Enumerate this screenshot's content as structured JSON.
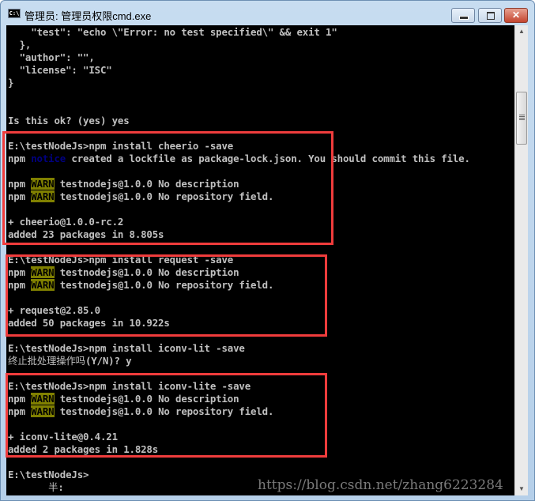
{
  "window": {
    "title": "管理员: 管理员权限cmd.exe",
    "icon": "cmd-icon",
    "icon_text": "C:\\_",
    "buttons": {
      "minimize": "minimize-icon",
      "maximize": "maximize-icon",
      "close": "✕"
    }
  },
  "console": {
    "lines": [
      {
        "text": "    \"test\": \"echo \\\"Error: no test specified\\\" && exit 1\""
      },
      {
        "text": "  },"
      },
      {
        "text": "  \"author\": \"\","
      },
      {
        "text": "  \"license\": \"ISC\""
      },
      {
        "text": "}"
      },
      {
        "text": ""
      },
      {
        "text": ""
      },
      {
        "text": "Is this ok? (yes) yes"
      },
      {
        "text": ""
      },
      {
        "text": "E:\\testNodeJs>npm install cheerio -save"
      },
      {
        "prefix": "npm ",
        "tag": "notice",
        "rest": " created a lockfile as package-lock.json. You should commit this file."
      },
      {
        "text": ""
      },
      {
        "prefix": "npm ",
        "tag": "WARN",
        "rest": " testnodejs@1.0.0 No description"
      },
      {
        "prefix": "npm ",
        "tag": "WARN",
        "rest": " testnodejs@1.0.0 No repository field."
      },
      {
        "text": ""
      },
      {
        "text": "+ cheerio@1.0.0-rc.2"
      },
      {
        "text": "added 23 packages in 8.805s"
      },
      {
        "text": ""
      },
      {
        "text": "E:\\testNodeJs>npm install request -save"
      },
      {
        "prefix": "npm ",
        "tag": "WARN",
        "rest": " testnodejs@1.0.0 No description"
      },
      {
        "prefix": "npm ",
        "tag": "WARN",
        "rest": " testnodejs@1.0.0 No repository field."
      },
      {
        "text": ""
      },
      {
        "text": "+ request@2.85.0"
      },
      {
        "text": "added 50 packages in 10.922s"
      },
      {
        "text": ""
      },
      {
        "text": "E:\\testNodeJs>npm install iconv-lit -save"
      },
      {
        "cjk": "终止批处理操作吗",
        "rest": "(Y/N)? y"
      },
      {
        "text": ""
      },
      {
        "text": "E:\\testNodeJs>npm install iconv-lite -save"
      },
      {
        "prefix": "npm ",
        "tag": "WARN",
        "rest": " testnodejs@1.0.0 No description"
      },
      {
        "prefix": "npm ",
        "tag": "WARN",
        "rest": " testnodejs@1.0.0 No repository field."
      },
      {
        "text": ""
      },
      {
        "text": "+ iconv-lite@0.4.21"
      },
      {
        "text": "added 2 packages in 1.828s"
      },
      {
        "text": ""
      },
      {
        "text": "E:\\testNodeJs>"
      },
      {
        "cjk_indent": "       ",
        "cjk": "半",
        "rest": ":"
      }
    ]
  },
  "watermark": "https://blog.csdn.net/zhang6223284",
  "colors": {
    "console_bg": "#000000",
    "console_fg": "#c0c0c0",
    "notice": "#000080",
    "warn_bg": "#808000",
    "highlight_box": "#f03c3c"
  }
}
